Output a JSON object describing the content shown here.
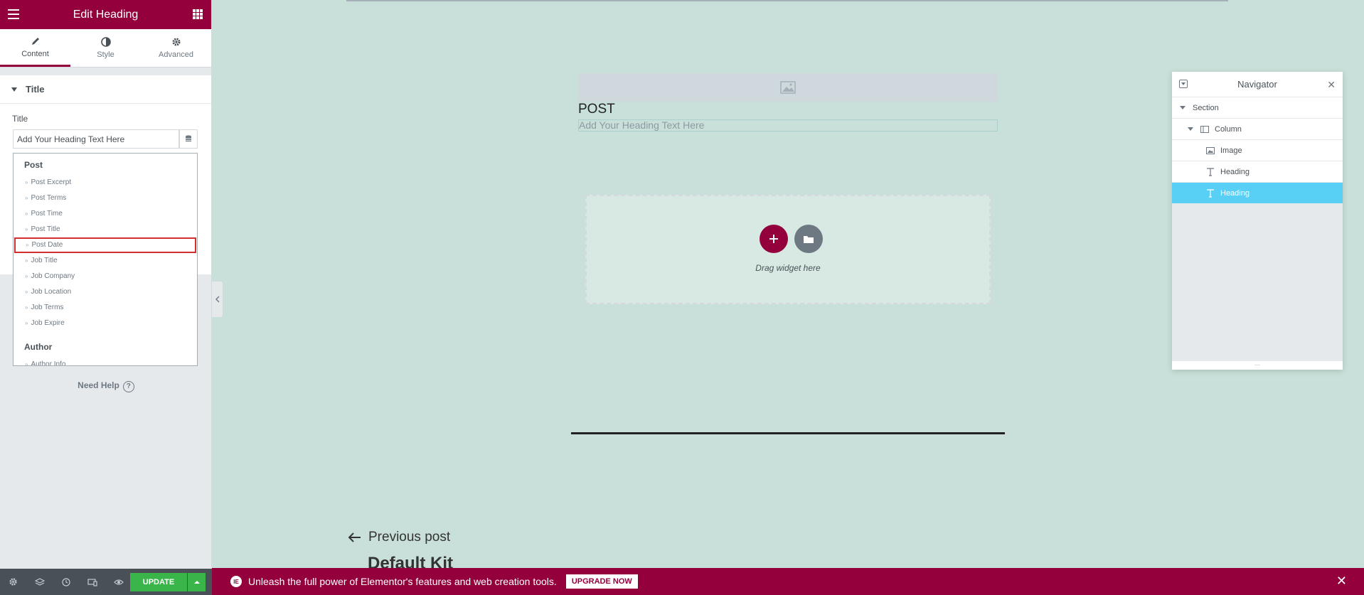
{
  "panel": {
    "title": "Edit Heading",
    "tabs": [
      {
        "label": "Content",
        "icon": "pencil-icon"
      },
      {
        "label": "Style",
        "icon": "half-circle-icon"
      },
      {
        "label": "Advanced",
        "icon": "gear-icon"
      }
    ],
    "section_title": "Title",
    "control_label": "Title",
    "input_value": "Add Your Heading Text Here",
    "dropdown": {
      "group1": "Post",
      "items1": [
        "Post Excerpt",
        "Post Terms",
        "Post Time",
        "Post Title",
        "Post Date",
        "Job Title",
        "Job Company",
        "Job Location",
        "Job Terms",
        "Job Expire"
      ],
      "highlighted": "Post Date",
      "group2": "Author",
      "items2": [
        "Author Info"
      ]
    },
    "need_help": "Need Help",
    "update_label": "UPDATE"
  },
  "canvas": {
    "post_heading": "POST",
    "placeholder_heading": "Add Your Heading Text Here",
    "drag_text": "Drag widget here",
    "prev_post": "Previous post",
    "kit_title": "Default Kit"
  },
  "navigator": {
    "title": "Navigator",
    "rows": [
      {
        "label": "Section",
        "icon": "caret-down-icon"
      },
      {
        "label": "Column",
        "icon": "column-icon"
      },
      {
        "label": "Image",
        "icon": "image-icon"
      },
      {
        "label": "Heading",
        "icon": "heading-icon"
      },
      {
        "label": "Heading",
        "icon": "heading-icon",
        "selected": true
      }
    ],
    "resize_handle": "..."
  },
  "promo": {
    "logo_text": "IE",
    "message": "Unleash the full power of Elementor's features and web creation tools.",
    "button": "UPGRADE NOW"
  },
  "colors": {
    "brand": "#93003c",
    "update": "#39b54a",
    "selected": "#58d0f5",
    "canvas_bg": "#c8e0d9"
  }
}
